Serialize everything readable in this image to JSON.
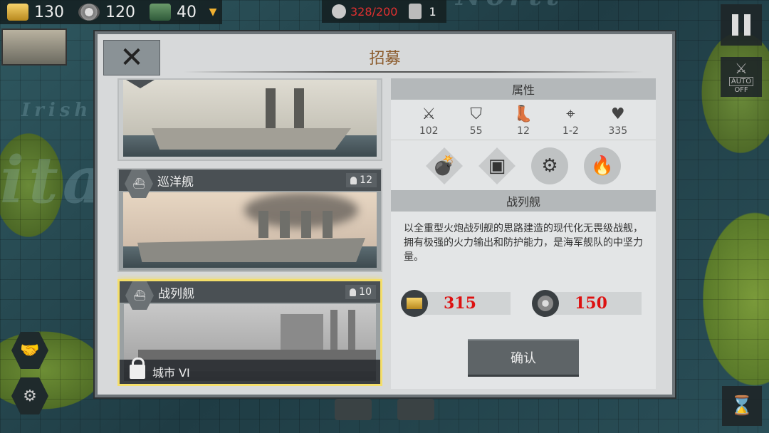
{
  "topbar": {
    "gold": "130",
    "steel": "120",
    "tech": "40",
    "population": "328/200",
    "cards": "1"
  },
  "map": {
    "words": [
      "ita",
      "Irish S",
      "Nortt"
    ]
  },
  "dialog": {
    "title": "招募",
    "ships": [
      {
        "name": "",
        "count": ""
      },
      {
        "name": "巡洋舰",
        "count": "12"
      },
      {
        "name": "战列舰",
        "count": "10",
        "lock": "城市 VI"
      }
    ],
    "attributes_header": "属性",
    "stats": [
      {
        "icon": "sword-icon",
        "value": "102"
      },
      {
        "icon": "shield-icon",
        "value": "55"
      },
      {
        "icon": "boot-icon",
        "value": "12"
      },
      {
        "icon": "crosshair-icon",
        "value": "1-2"
      },
      {
        "icon": "heart-icon",
        "value": "335"
      }
    ],
    "abilities": [
      "cannon-icon",
      "armor-icon",
      "artillery-icon",
      "fire-icon"
    ],
    "unit_name": "战列舰",
    "description": "以全重型火炮战列舰的思路建造的现代化无畏级战舰，拥有极强的火力输出和防护能力，是海军舰队的中坚力量。",
    "cost_gold": "315",
    "cost_steel": "150",
    "confirm": "确认"
  },
  "buttons": {
    "auto_label": "AUTO",
    "auto_state": "OFF"
  },
  "colors": {
    "title": "#8b5a2b",
    "cost": "#dd1111",
    "selected_border": "#f4de6a",
    "population_red": "#e03030"
  }
}
